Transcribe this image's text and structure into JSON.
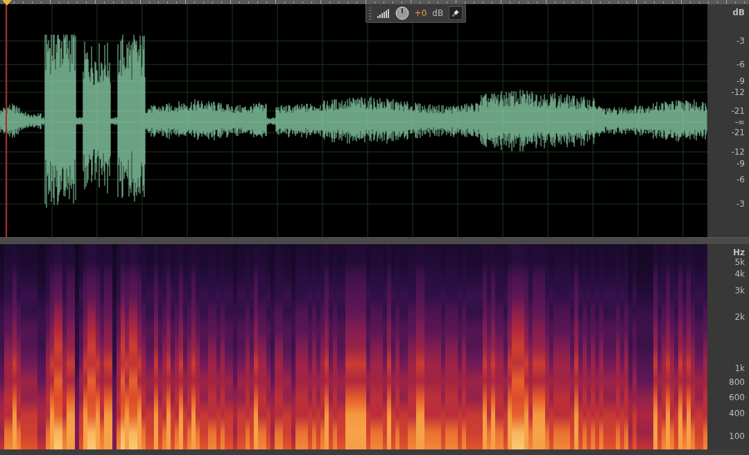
{
  "toolbar": {
    "gain_value": "+0",
    "gain_unit": "dB"
  },
  "waveform": {
    "axis_unit": "dB",
    "axis_labels": [
      "-3",
      "-6",
      "-9",
      "-12",
      "-21",
      "-∞",
      "-21",
      "-12",
      "-9",
      "-6",
      "-3"
    ]
  },
  "spectrogram": {
    "axis_unit": "Hz",
    "axis_labels": [
      "5k",
      "4k",
      "3k",
      "2k",
      "1k",
      "800",
      "600",
      "400",
      "100"
    ]
  }
}
